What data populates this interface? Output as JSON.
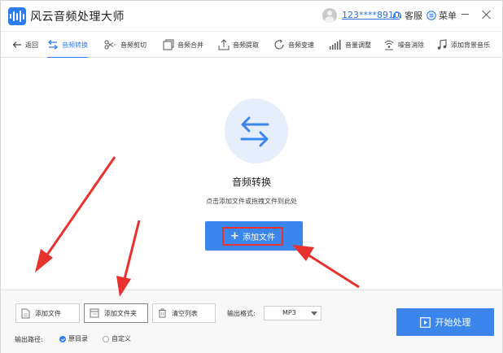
{
  "app": {
    "title": "风云音频处理大师"
  },
  "header": {
    "user_id": "123****8910",
    "service_label": "客服",
    "menu_label": "菜单"
  },
  "toolbar": {
    "back_label": "返回",
    "tools": [
      {
        "label": "音频转换",
        "icon": "convert-icon",
        "active": true
      },
      {
        "label": "音频剪切",
        "icon": "scissors-icon",
        "active": false
      },
      {
        "label": "音频合并",
        "icon": "merge-icon",
        "active": false
      },
      {
        "label": "音频提取",
        "icon": "extract-icon",
        "active": false
      },
      {
        "label": "音频变速",
        "icon": "speed-icon",
        "active": false
      },
      {
        "label": "音量调整",
        "icon": "volume-icon",
        "active": false
      },
      {
        "label": "噪音消除",
        "icon": "noise-icon",
        "active": false
      },
      {
        "label": "添加背景音乐",
        "icon": "music-note-icon",
        "active": false
      }
    ]
  },
  "main": {
    "title": "音频转换",
    "subtitle": "点击添加文件或拖拽文件到此处",
    "add_file_label": "添加文件"
  },
  "bottom": {
    "add_file_label": "添加文件",
    "add_folder_label": "添加文件夹",
    "clear_list_label": "清空列表",
    "output_format_label": "输出格式:",
    "output_format_value": "MP3",
    "output_path_label": "输出路径:",
    "path_options": [
      {
        "label": "原目录",
        "selected": true
      },
      {
        "label": "自定义",
        "selected": false
      }
    ],
    "start_label": "开始处理"
  },
  "colors": {
    "accent": "#2d7cf0",
    "button": "#3b86ed",
    "annotation": "#e8322d"
  }
}
